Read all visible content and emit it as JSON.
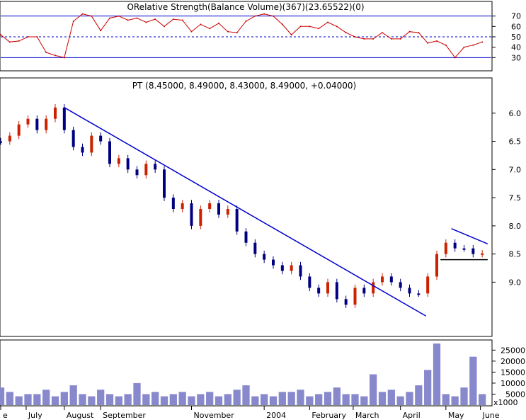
{
  "panels": {
    "indicator_title": "ORelative Strength(Balance Volume)(367)(23.65522)(0)",
    "price_title": "PT (8.45000, 8.49000, 8.43000, 8.49000, +0.04000)",
    "volume_unit": "x1000"
  },
  "x_axis": {
    "labels": [
      {
        "x": 0,
        "text": "e"
      },
      {
        "x": 28,
        "text": "July"
      },
      {
        "x": 70,
        "text": "August"
      },
      {
        "x": 110,
        "text": "September"
      },
      {
        "x": 210,
        "text": "November"
      },
      {
        "x": 290,
        "text": "2004"
      },
      {
        "x": 340,
        "text": "February"
      },
      {
        "x": 388,
        "text": "March"
      },
      {
        "x": 440,
        "text": "April"
      },
      {
        "x": 490,
        "text": "May"
      },
      {
        "x": 528,
        "text": "June"
      }
    ]
  },
  "chart_data": [
    {
      "type": "line",
      "name": "Relative Strength",
      "y_ticks": [
        30,
        40,
        50,
        60,
        70
      ],
      "ylim": [
        20,
        80
      ],
      "reference_lines": [
        70,
        50,
        30
      ],
      "x": [
        0,
        10,
        20,
        30,
        40,
        50,
        60,
        70,
        80,
        90,
        100,
        110,
        120,
        130,
        140,
        150,
        160,
        170,
        180,
        190,
        200,
        210,
        220,
        230,
        240,
        250,
        260,
        270,
        280,
        290,
        300,
        310,
        320,
        330,
        340,
        350,
        360,
        370,
        380,
        390,
        400,
        410,
        420,
        430,
        440,
        450,
        460,
        470,
        480,
        490,
        500,
        510,
        520,
        530
      ],
      "values": [
        52,
        45,
        46,
        50,
        50,
        35,
        32,
        30,
        65,
        72,
        70,
        56,
        68,
        70,
        66,
        68,
        64,
        67,
        60,
        67,
        66,
        55,
        62,
        58,
        63,
        55,
        54,
        65,
        70,
        72,
        70,
        62,
        52,
        60,
        60,
        58,
        64,
        60,
        54,
        50,
        48,
        48,
        54,
        48,
        48,
        55,
        54,
        44,
        46,
        42,
        30,
        40,
        42,
        45
      ],
      "color": "#cc0000"
    },
    {
      "type": "candlestick",
      "name": "PT",
      "y_ticks": [
        6.0,
        6.5,
        7.0,
        7.5,
        8.0,
        8.5,
        9.0
      ],
      "ylim": [
        5.5,
        9.9
      ],
      "inverted_axis": true,
      "x": [
        0,
        10,
        20,
        30,
        40,
        50,
        60,
        70,
        80,
        90,
        100,
        110,
        120,
        130,
        140,
        150,
        160,
        170,
        180,
        190,
        200,
        210,
        220,
        230,
        240,
        250,
        260,
        270,
        280,
        290,
        300,
        310,
        320,
        330,
        340,
        350,
        360,
        370,
        380,
        390,
        400,
        410,
        420,
        430,
        440,
        450,
        460,
        470,
        480,
        490,
        500,
        510,
        520,
        530
      ],
      "close": [
        6.5,
        6.4,
        6.2,
        6.1,
        6.3,
        6.1,
        5.9,
        6.3,
        6.6,
        6.7,
        6.4,
        6.5,
        6.9,
        6.8,
        7.0,
        7.1,
        6.9,
        7.0,
        7.5,
        7.7,
        7.6,
        8.0,
        7.7,
        7.6,
        7.8,
        7.7,
        8.1,
        8.3,
        8.5,
        8.6,
        8.7,
        8.8,
        8.7,
        8.9,
        9.1,
        9.2,
        9.0,
        9.3,
        9.4,
        9.1,
        9.2,
        9.0,
        8.9,
        9.0,
        9.1,
        9.2,
        9.2,
        8.9,
        8.5,
        8.3,
        8.4,
        8.4,
        8.5,
        8.49
      ],
      "color_up": "#cc2200",
      "color_down": "#000080",
      "trendlines": [
        {
          "label": "downtrend",
          "from": {
            "x": 70,
            "y": 5.9
          },
          "to": {
            "x": 468,
            "y": 9.6
          },
          "color": "#0000cc"
        },
        {
          "label": "upper wedge",
          "from": {
            "x": 496,
            "y": 8.05
          },
          "to": {
            "x": 536,
            "y": 8.32
          },
          "color": "#0000cc"
        },
        {
          "label": "support",
          "from": {
            "x": 484,
            "y": 8.6
          },
          "to": {
            "x": 536,
            "y": 8.6
          },
          "color": "#000000"
        }
      ]
    },
    {
      "type": "bar",
      "name": "Volume",
      "y_ticks": [
        5000,
        10000,
        15000,
        20000,
        25000
      ],
      "ylim": [
        0,
        28000
      ],
      "x": [
        0,
        10,
        20,
        30,
        40,
        50,
        60,
        70,
        80,
        90,
        100,
        110,
        120,
        130,
        140,
        150,
        160,
        170,
        180,
        190,
        200,
        210,
        220,
        230,
        240,
        250,
        260,
        270,
        280,
        290,
        300,
        310,
        320,
        330,
        340,
        350,
        360,
        370,
        380,
        390,
        400,
        410,
        420,
        430,
        440,
        450,
        460,
        470,
        480,
        490,
        500,
        510,
        520,
        530
      ],
      "values": [
        8000,
        6000,
        4000,
        5000,
        5000,
        7000,
        4000,
        6000,
        9000,
        5000,
        4000,
        7000,
        5000,
        4000,
        5000,
        10000,
        5000,
        6000,
        4000,
        5000,
        6000,
        4000,
        5000,
        6000,
        4000,
        5000,
        7000,
        9000,
        4000,
        5000,
        4000,
        6000,
        6000,
        7000,
        4000,
        5000,
        6000,
        8000,
        5000,
        5000,
        4000,
        14000,
        6000,
        7000,
        4000,
        6000,
        9000,
        16000,
        28000,
        5000,
        4000,
        8000,
        22000,
        5000
      ],
      "color": "#8888cc"
    }
  ]
}
